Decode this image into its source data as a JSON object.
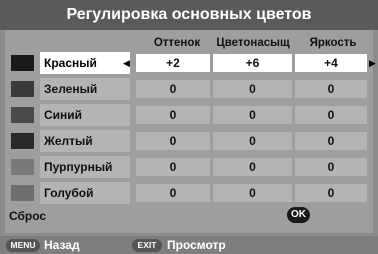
{
  "title": "Регулировка основных цветов",
  "columns": [
    "Оттенок",
    "Цветонасыщ",
    "Яркость"
  ],
  "rows": [
    {
      "label": "Красный",
      "color": "#1a1a1a",
      "values": [
        "+2",
        "+6",
        "+4"
      ],
      "selected": true
    },
    {
      "label": "Зеленый",
      "color": "#3a3a3a",
      "values": [
        "0",
        "0",
        "0"
      ]
    },
    {
      "label": "Синий",
      "color": "#4a4a4a",
      "values": [
        "0",
        "0",
        "0"
      ]
    },
    {
      "label": "Желтый",
      "color": "#2a2a2a",
      "values": [
        "0",
        "0",
        "0"
      ]
    },
    {
      "label": "Пурпурный",
      "color": "#7a7a7a",
      "values": [
        "0",
        "0",
        "0"
      ]
    },
    {
      "label": "Голубой",
      "color": "#6e6e6e",
      "values": [
        "0",
        "0",
        "0"
      ]
    }
  ],
  "reset_label": "Сброс",
  "ok_label": "OK",
  "footer": {
    "menu_key": "MENU",
    "menu_label": "Назад",
    "exit_key": "EXIT",
    "exit_label": "Просмотр"
  }
}
